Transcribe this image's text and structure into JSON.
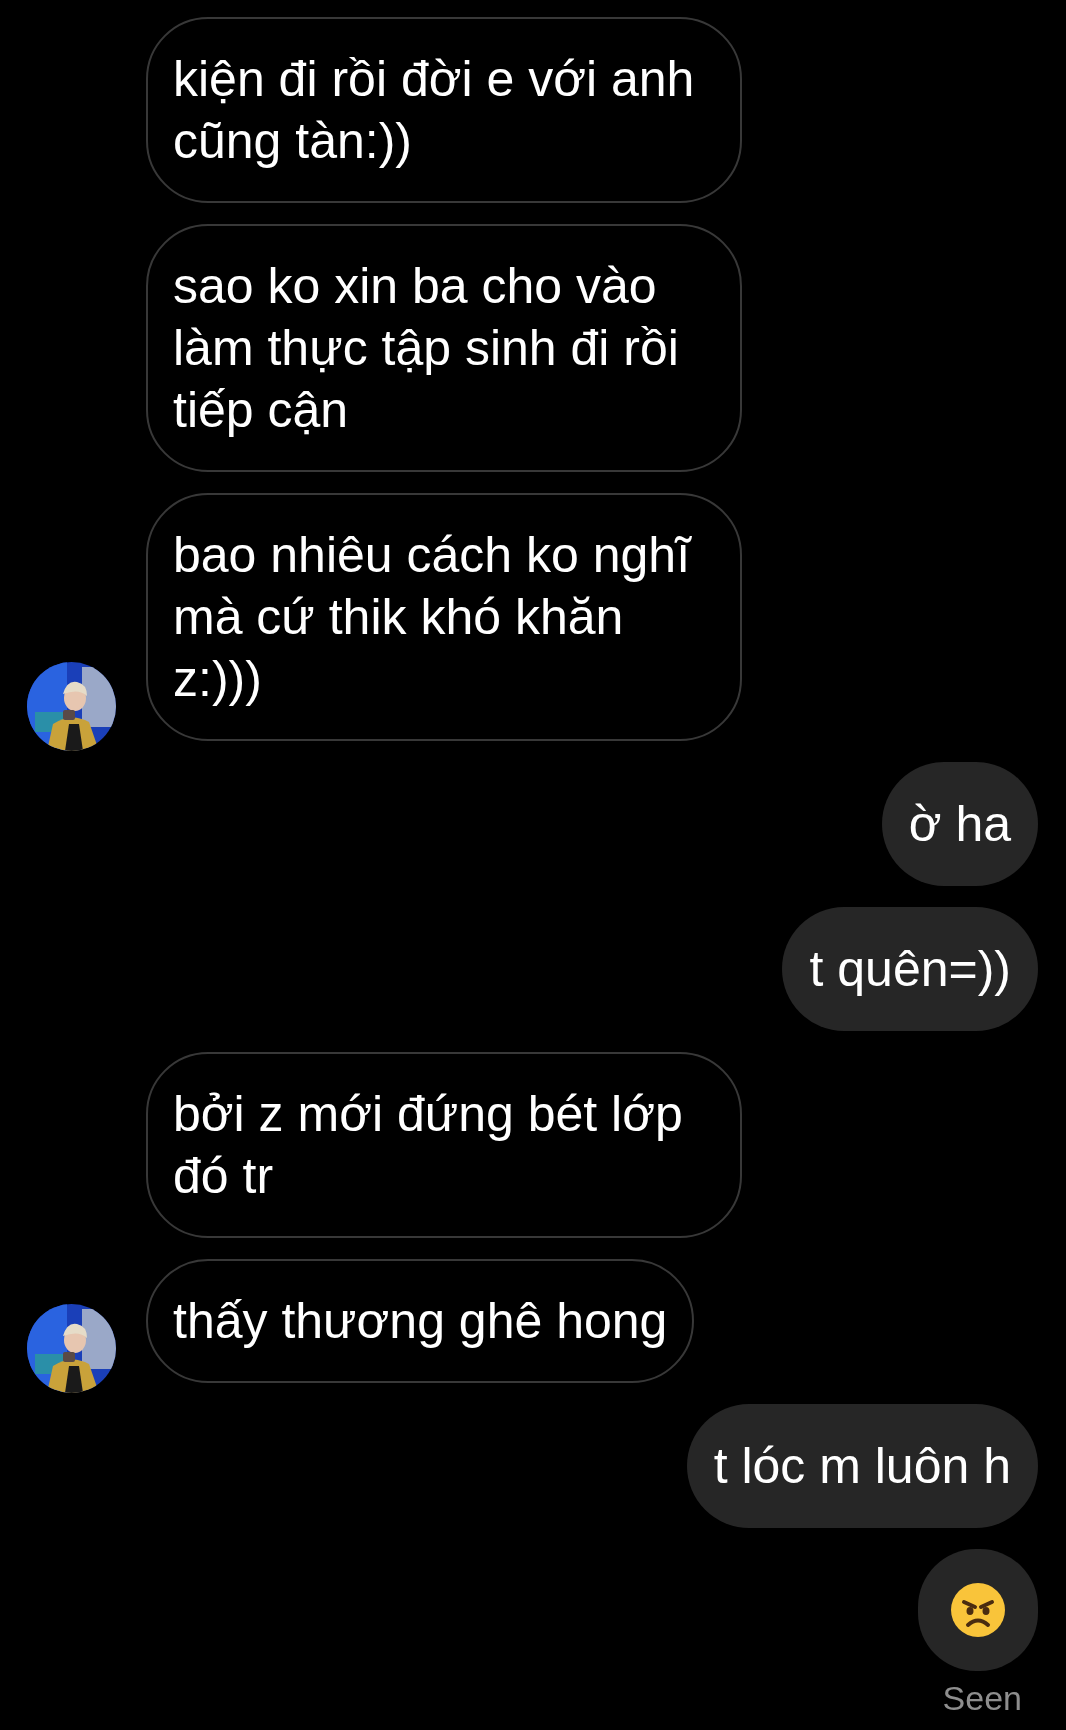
{
  "messages": [
    {
      "outgoing": false,
      "kind": "text",
      "text": "kiện đi rồi đời e với anh cũng tàn:))",
      "avatar": false
    },
    {
      "outgoing": false,
      "kind": "text",
      "text": "sao ko xin ba cho vào làm thực tập sinh đi rồi tiếp cận",
      "avatar": false
    },
    {
      "outgoing": false,
      "kind": "text",
      "text": "bao nhiêu cách ko nghĩ mà cứ thik khó khăn z:)))",
      "avatar": true
    },
    {
      "outgoing": true,
      "kind": "text",
      "text": "ờ ha"
    },
    {
      "outgoing": true,
      "kind": "text",
      "text": "t quên=))"
    },
    {
      "outgoing": false,
      "kind": "text",
      "text": "bởi z mới đứng bét lớp đó tr",
      "avatar": false
    },
    {
      "outgoing": false,
      "kind": "text",
      "text": "thấy thương ghê hong",
      "avatar": true
    },
    {
      "outgoing": true,
      "kind": "text",
      "text": "t lóc m luôn h"
    },
    {
      "outgoing": true,
      "kind": "emoji"
    }
  ],
  "status": "Seen"
}
